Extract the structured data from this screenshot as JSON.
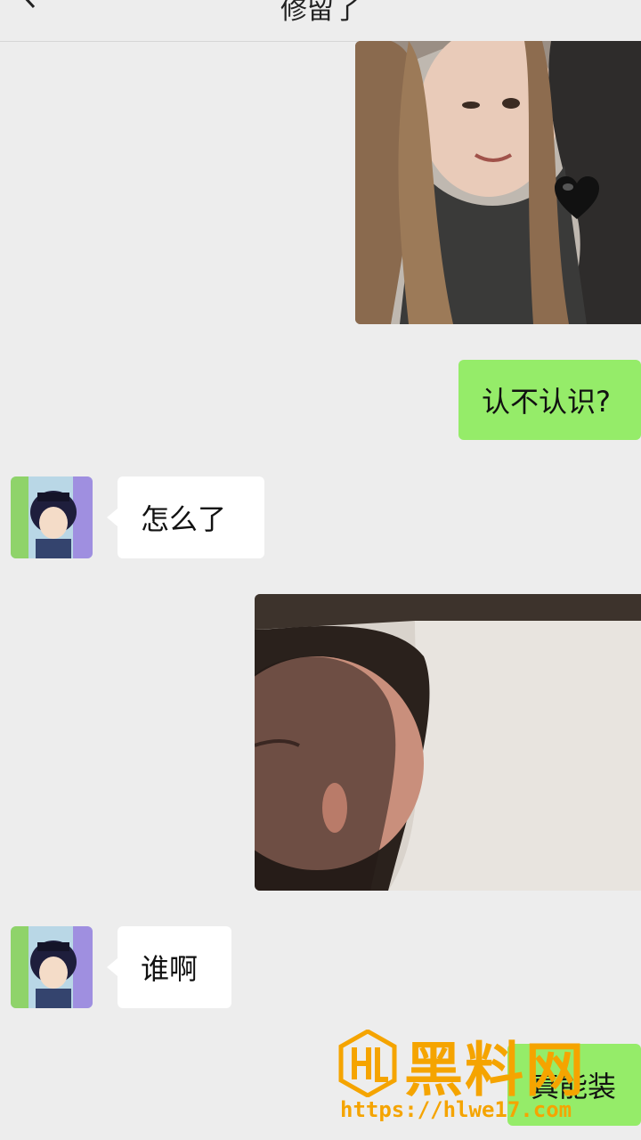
{
  "header": {
    "title": "修留了"
  },
  "messages": [
    {
      "id": "m1",
      "side": "out",
      "type": "image"
    },
    {
      "id": "m2",
      "side": "out",
      "type": "text",
      "text": "认不认识?"
    },
    {
      "id": "m3",
      "side": "in",
      "type": "text",
      "text": "怎么了"
    },
    {
      "id": "m4",
      "side": "out",
      "type": "image"
    },
    {
      "id": "m5",
      "side": "in",
      "type": "text",
      "text": "谁啊"
    },
    {
      "id": "m6",
      "side": "out",
      "type": "text",
      "text": "真能装"
    }
  ],
  "watermark": {
    "title": "黑料网",
    "url": "https://hlwe17.com"
  },
  "colors": {
    "background": "#ededed",
    "outgoing_bubble": "#95ec69",
    "incoming_bubble": "#ffffff",
    "watermark": "#f5a400"
  }
}
